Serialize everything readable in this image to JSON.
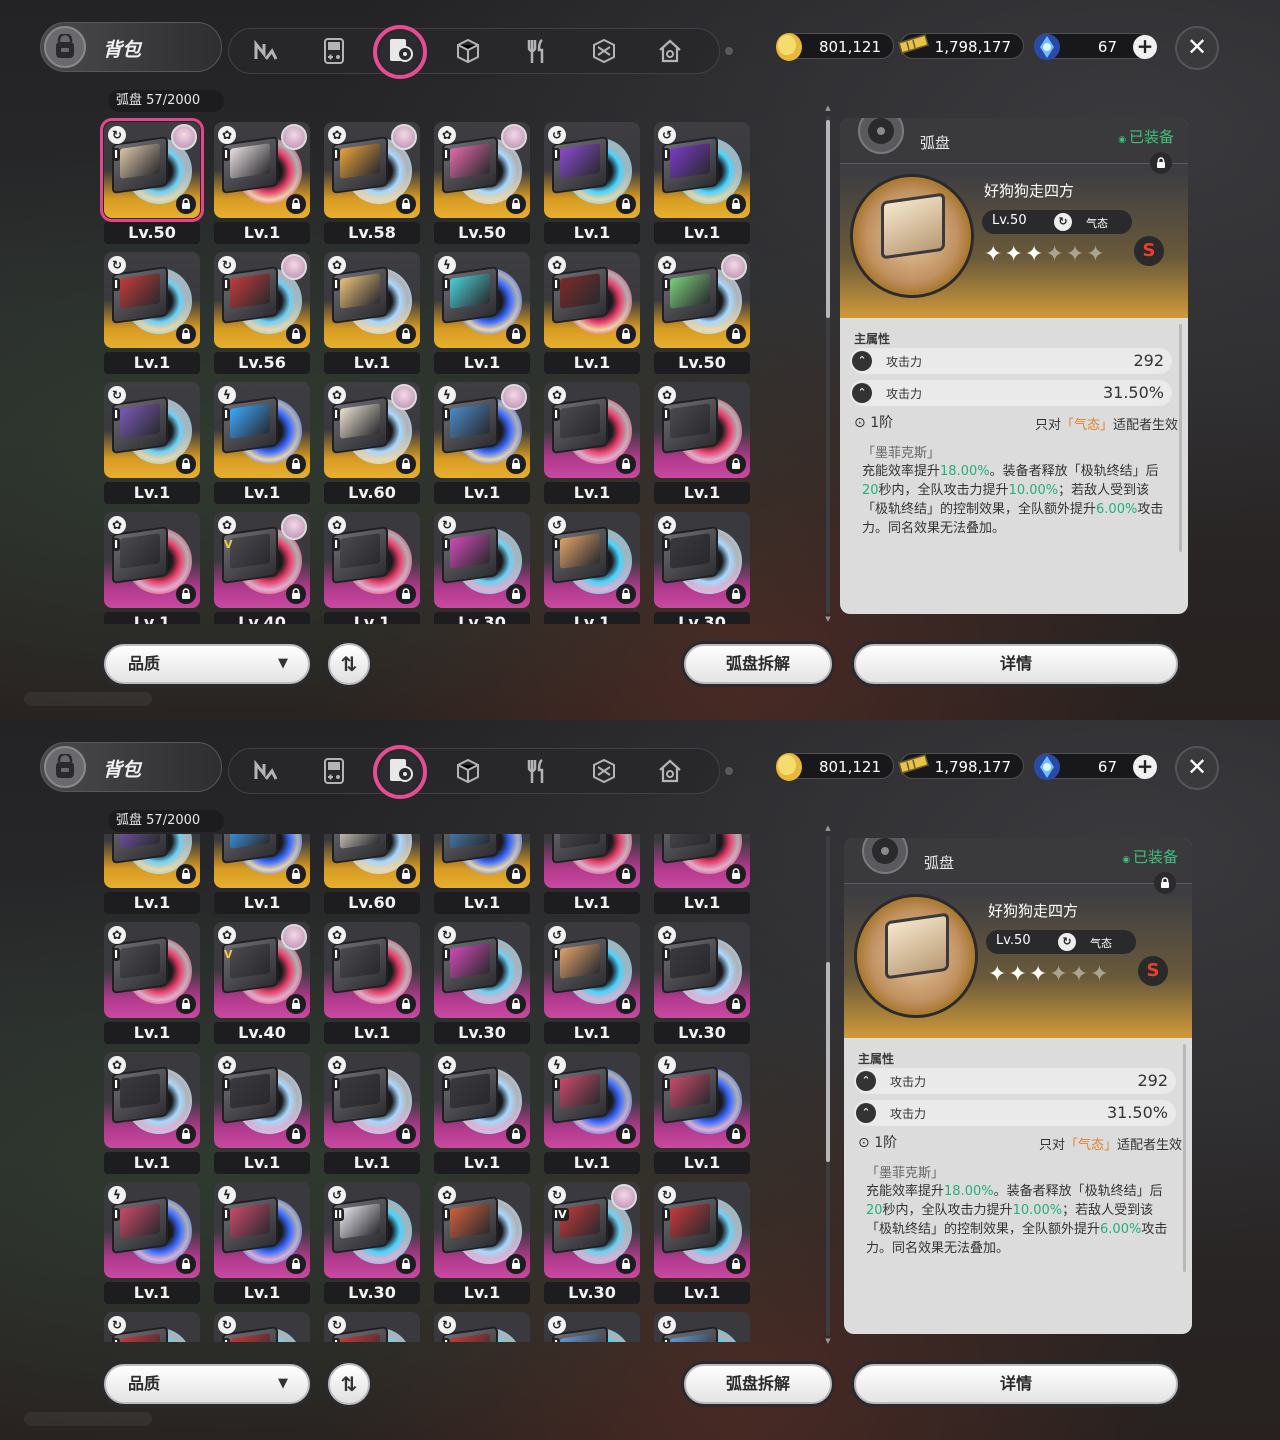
{
  "header": {
    "bag_title": "背包",
    "tabs": [
      {
        "icon": "n-logo-icon"
      },
      {
        "icon": "gameboy-icon"
      },
      {
        "icon": "disc-box-icon",
        "active": true
      },
      {
        "icon": "cube-icon"
      },
      {
        "icon": "fork-knife-icon"
      },
      {
        "icon": "cube-outline-icon"
      },
      {
        "icon": "house-icon"
      }
    ],
    "currencies": [
      {
        "name": "coin",
        "value": "801,121",
        "icon": "gold-coin-icon"
      },
      {
        "name": "ticket",
        "value": "1,798,177",
        "icon": "ticket-icon"
      },
      {
        "name": "crystal",
        "value": "67",
        "icon": "blue-crystal-icon"
      }
    ]
  },
  "inventory": {
    "label": "弧盘",
    "count": "57/2000"
  },
  "items": [
    {
      "lv": "Lv.50",
      "frame": "gold",
      "type": "↻",
      "rank": "I",
      "avatar": true,
      "disc": "#6fd0f5",
      "art": "#d9c4a7",
      "selected": true
    },
    {
      "lv": "Lv.1",
      "frame": "gold",
      "type": "✿",
      "rank": "I",
      "avatar": true,
      "disc": "#ea3d6a",
      "art": "#e8dfe0"
    },
    {
      "lv": "Lv.58",
      "frame": "gold",
      "type": "✿",
      "rank": "I",
      "avatar": true,
      "disc": "#a8d8ff",
      "art": "#e8a23a"
    },
    {
      "lv": "Lv.50",
      "frame": "gold",
      "type": "✿",
      "rank": "I",
      "avatar": true,
      "disc": "#a8d8ff",
      "art": "#e26aa8"
    },
    {
      "lv": "Lv.1",
      "frame": "gold",
      "type": "↺",
      "rank": "I",
      "avatar": false,
      "disc": "#49d4ff",
      "art": "#8a4ad0"
    },
    {
      "lv": "Lv.1",
      "frame": "gold",
      "type": "↺",
      "rank": "I",
      "avatar": false,
      "disc": "#49d4ff",
      "art": "#7a3ac8"
    },
    {
      "lv": "Lv.1",
      "frame": "gold",
      "type": "↻",
      "rank": "I",
      "avatar": false,
      "disc": "#6fd0f5",
      "art": "#c23a3a"
    },
    {
      "lv": "Lv.56",
      "frame": "gold",
      "type": "↻",
      "rank": "I",
      "avatar": true,
      "disc": "#6fd0f5",
      "art": "#c23a3a"
    },
    {
      "lv": "Lv.1",
      "frame": "gold",
      "type": "✿",
      "rank": "I",
      "avatar": false,
      "disc": "#a8d8ff",
      "art": "#e8c07a"
    },
    {
      "lv": "Lv.1",
      "frame": "gold",
      "type": "ϟ",
      "rank": "I",
      "avatar": false,
      "disc": "#3a6aff",
      "art": "#4ad0d8"
    },
    {
      "lv": "Lv.1",
      "frame": "gold",
      "type": "✿",
      "rank": "I",
      "avatar": false,
      "disc": "#ea3d6a",
      "art": "#7a2a2a"
    },
    {
      "lv": "Lv.50",
      "frame": "gold",
      "type": "✿",
      "rank": "I",
      "avatar": true,
      "disc": "#a8d8ff",
      "art": "#7ad07a"
    },
    {
      "lv": "Lv.1",
      "frame": "gold",
      "type": "↻",
      "rank": "I",
      "avatar": false,
      "disc": "#6fd0f5",
      "art": "#7a5ab8"
    },
    {
      "lv": "Lv.1",
      "frame": "gold",
      "type": "ϟ",
      "rank": "I",
      "avatar": false,
      "disc": "#3a6aff",
      "art": "#3aa8ff"
    },
    {
      "lv": "Lv.60",
      "frame": "gold",
      "type": "✿",
      "rank": "I",
      "avatar": true,
      "disc": "#a8d8ff",
      "art": "#e8e0d0"
    },
    {
      "lv": "Lv.1",
      "frame": "gold",
      "type": "ϟ",
      "rank": "I",
      "avatar": true,
      "disc": "#3a6aff",
      "art": "#4a8ac8"
    },
    {
      "lv": "Lv.1",
      "frame": "purple",
      "type": "✿",
      "rank": "I",
      "avatar": false,
      "disc": "#ea3d6a",
      "art": "#4a4a4e"
    },
    {
      "lv": "Lv.1",
      "frame": "purple",
      "type": "✿",
      "rank": "I",
      "avatar": false,
      "disc": "#ea3d6a",
      "art": "#4a4a4e"
    },
    {
      "lv": "Lv.1",
      "frame": "purple",
      "type": "✿",
      "rank": "I",
      "avatar": false,
      "disc": "#ea3d6a",
      "art": "#4a4a4e"
    },
    {
      "lv": "Lv.40",
      "frame": "purple",
      "type": "✿",
      "rank": "V",
      "avatar": true,
      "disc": "#ea3d6a",
      "art": "#4a4a4e"
    },
    {
      "lv": "Lv.1",
      "frame": "purple",
      "type": "✿",
      "rank": "I",
      "avatar": false,
      "disc": "#ea3d6a",
      "art": "#4a4a4e"
    },
    {
      "lv": "Lv.30",
      "frame": "purple",
      "type": "↻",
      "rank": "I",
      "avatar": false,
      "disc": "#6fd0f5",
      "art": "#d04ab8"
    },
    {
      "lv": "Lv.1",
      "frame": "purple",
      "type": "↺",
      "rank": "I",
      "avatar": false,
      "disc": "#49d4ff",
      "art": "#e0a26a"
    },
    {
      "lv": "Lv.30",
      "frame": "purple",
      "type": "✿",
      "rank": "I",
      "avatar": false,
      "disc": "#a8d8ff",
      "art": "#3a3a3e"
    },
    {
      "lv": "Lv.1",
      "frame": "purple",
      "type": "✿",
      "rank": "I",
      "avatar": false,
      "disc": "#a8d8ff",
      "art": "#3a3a3e"
    },
    {
      "lv": "Lv.1",
      "frame": "purple",
      "type": "✿",
      "rank": "I",
      "avatar": false,
      "disc": "#a8d8ff",
      "art": "#3a3a3e"
    },
    {
      "lv": "Lv.1",
      "frame": "purple",
      "type": "✿",
      "rank": "I",
      "avatar": false,
      "disc": "#a8d8ff",
      "art": "#3a3a3e"
    },
    {
      "lv": "Lv.1",
      "frame": "purple",
      "type": "✿",
      "rank": "I",
      "avatar": false,
      "disc": "#a8d8ff",
      "art": "#3a3a3e"
    },
    {
      "lv": "Lv.1",
      "frame": "purple",
      "type": "ϟ",
      "rank": "I",
      "avatar": false,
      "disc": "#3a6aff",
      "art": "#c84a6a"
    },
    {
      "lv": "Lv.1",
      "frame": "purple",
      "type": "ϟ",
      "rank": "I",
      "avatar": false,
      "disc": "#3a6aff",
      "art": "#c84a6a"
    },
    {
      "lv": "Lv.1",
      "frame": "purple",
      "type": "ϟ",
      "rank": "I",
      "avatar": false,
      "disc": "#3a6aff",
      "art": "#c84a6a"
    },
    {
      "lv": "Lv.1",
      "frame": "purple",
      "type": "ϟ",
      "rank": "I",
      "avatar": false,
      "disc": "#3a6aff",
      "art": "#c84a6a"
    },
    {
      "lv": "Lv.30",
      "frame": "purple",
      "type": "↺",
      "rank": "II",
      "avatar": false,
      "disc": "#49d4ff",
      "art": "#e8e8f0"
    },
    {
      "lv": "Lv.1",
      "frame": "purple",
      "type": "✿",
      "rank": "I",
      "avatar": false,
      "disc": "#a8d8ff",
      "art": "#d0603a"
    },
    {
      "lv": "Lv.30",
      "frame": "purple",
      "type": "↻",
      "rank": "IV",
      "avatar": true,
      "disc": "#6fd0f5",
      "art": "#c23a3a"
    },
    {
      "lv": "Lv.1",
      "frame": "purple",
      "type": "↻",
      "rank": "I",
      "avatar": false,
      "disc": "#6fd0f5",
      "art": "#c23a3a"
    },
    {
      "lv": "",
      "frame": "purple",
      "type": "↻",
      "rank": "I",
      "avatar": false,
      "disc": "#6fd0f5",
      "art": "#c23a3a"
    },
    {
      "lv": "",
      "frame": "purple",
      "type": "↻",
      "rank": "I",
      "avatar": false,
      "disc": "#6fd0f5",
      "art": "#c23a3a"
    },
    {
      "lv": "",
      "frame": "purple",
      "type": "↻",
      "rank": "I",
      "avatar": false,
      "disc": "#6fd0f5",
      "art": "#c23a3a"
    },
    {
      "lv": "",
      "frame": "purple",
      "type": "↻",
      "rank": "I",
      "avatar": false,
      "disc": "#6fd0f5",
      "art": "#c23a3a"
    },
    {
      "lv": "",
      "frame": "purple",
      "type": "↺",
      "rank": "I",
      "avatar": false,
      "disc": "#49d4ff",
      "art": "#6a9ad0"
    },
    {
      "lv": "",
      "frame": "purple",
      "type": "↺",
      "rank": "I",
      "avatar": false,
      "disc": "#49d4ff",
      "art": "#6a9ad0"
    }
  ],
  "detail": {
    "category": "弧盘",
    "equipped": "已装备",
    "name": "好狗狗走四方",
    "level": "Lv.50",
    "attribute": "气态",
    "attribute_icon": "swirl-icon",
    "stars_filled": 3,
    "stars_total": 6,
    "grade_badge": "S",
    "main_stats_title": "主属性",
    "stats": [
      {
        "name": "攻击力",
        "value": "292"
      },
      {
        "name": "攻击力",
        "value": "31.50%"
      }
    ],
    "tier": "1阶",
    "tier_note_prefix": "只对",
    "tier_note_attr": "「气态」",
    "tier_note_suffix": "适配者生效",
    "effect_title": "「墨菲克斯」",
    "effect_parts": [
      {
        "t": "充能效率提升",
        "g": false
      },
      {
        "t": "18.00%",
        "g": true
      },
      {
        "t": "。",
        "g": false
      },
      {
        "t": "装备者释放「极轨终结」后",
        "g": false
      },
      {
        "t": "20",
        "g": true
      },
      {
        "t": "秒内，全队攻击力提升",
        "g": false
      },
      {
        "t": "10.00%",
        "g": true
      },
      {
        "t": "；若敌人受到该「极轨终结」的控制效果，全队额外提升",
        "g": false
      },
      {
        "t": "6.00%",
        "g": true
      },
      {
        "t": "攻击力。同名效果无法叠加。",
        "g": false
      }
    ]
  },
  "footer": {
    "quality_filter": "品质",
    "dismantle_button": "弧盘拆解",
    "details_button": "详情"
  },
  "colors": {
    "accent_pink": "#e54c93",
    "gold_frame": "#e7b030",
    "purple_frame": "#c84aa0",
    "equipped_green": "#3ec07a",
    "effect_green": "#23b07a",
    "attr_orange": "#e2812c"
  }
}
